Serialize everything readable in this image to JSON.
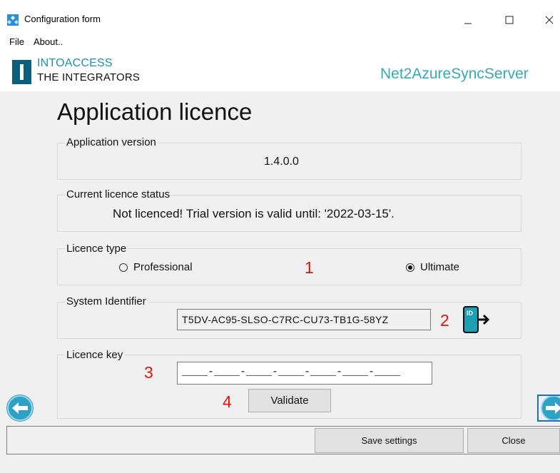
{
  "window": {
    "title": "Configuration form",
    "minimize_label": "—",
    "maximize_label": "☐",
    "close_label": "✕"
  },
  "menu": {
    "items": [
      {
        "label": "File"
      },
      {
        "label": "About.."
      }
    ]
  },
  "brand": {
    "company_line1": "INTOACCESS",
    "company_line2": "THE INTEGRATORS",
    "product": "Net2AzureSyncServer"
  },
  "page": {
    "title": "Application licence"
  },
  "app_version": {
    "label": "Application version",
    "value": "1.4.0.0"
  },
  "licence_status": {
    "label": "Current licence status",
    "value": "Not licenced! Trial version is valid until: '2022-03-15'."
  },
  "licence_type": {
    "label": "Licence type",
    "options": [
      {
        "label": "Professional",
        "selected": false
      },
      {
        "label": "Ultimate",
        "selected": true
      }
    ]
  },
  "system_identifier": {
    "label": "System Identifier",
    "value": "T5DV-AC95-SLSO-C7RC-CU73-TB1G-58YZ",
    "export_icon": "id-export-icon"
  },
  "licence_key": {
    "label": "Licence key",
    "value": "____-____-____-____-____-____-____",
    "validate_label": "Validate"
  },
  "annotations": {
    "one": "1",
    "two": "2",
    "three": "3",
    "four": "4"
  },
  "footer": {
    "save_label": "Save settings",
    "close_label": "Close"
  },
  "colors": {
    "accent_teal": "#1f8fa6",
    "annotation_red": "#e0140f",
    "nav_blue": "#2ea1c7",
    "logo_dark_teal": "#0a5f7f"
  }
}
